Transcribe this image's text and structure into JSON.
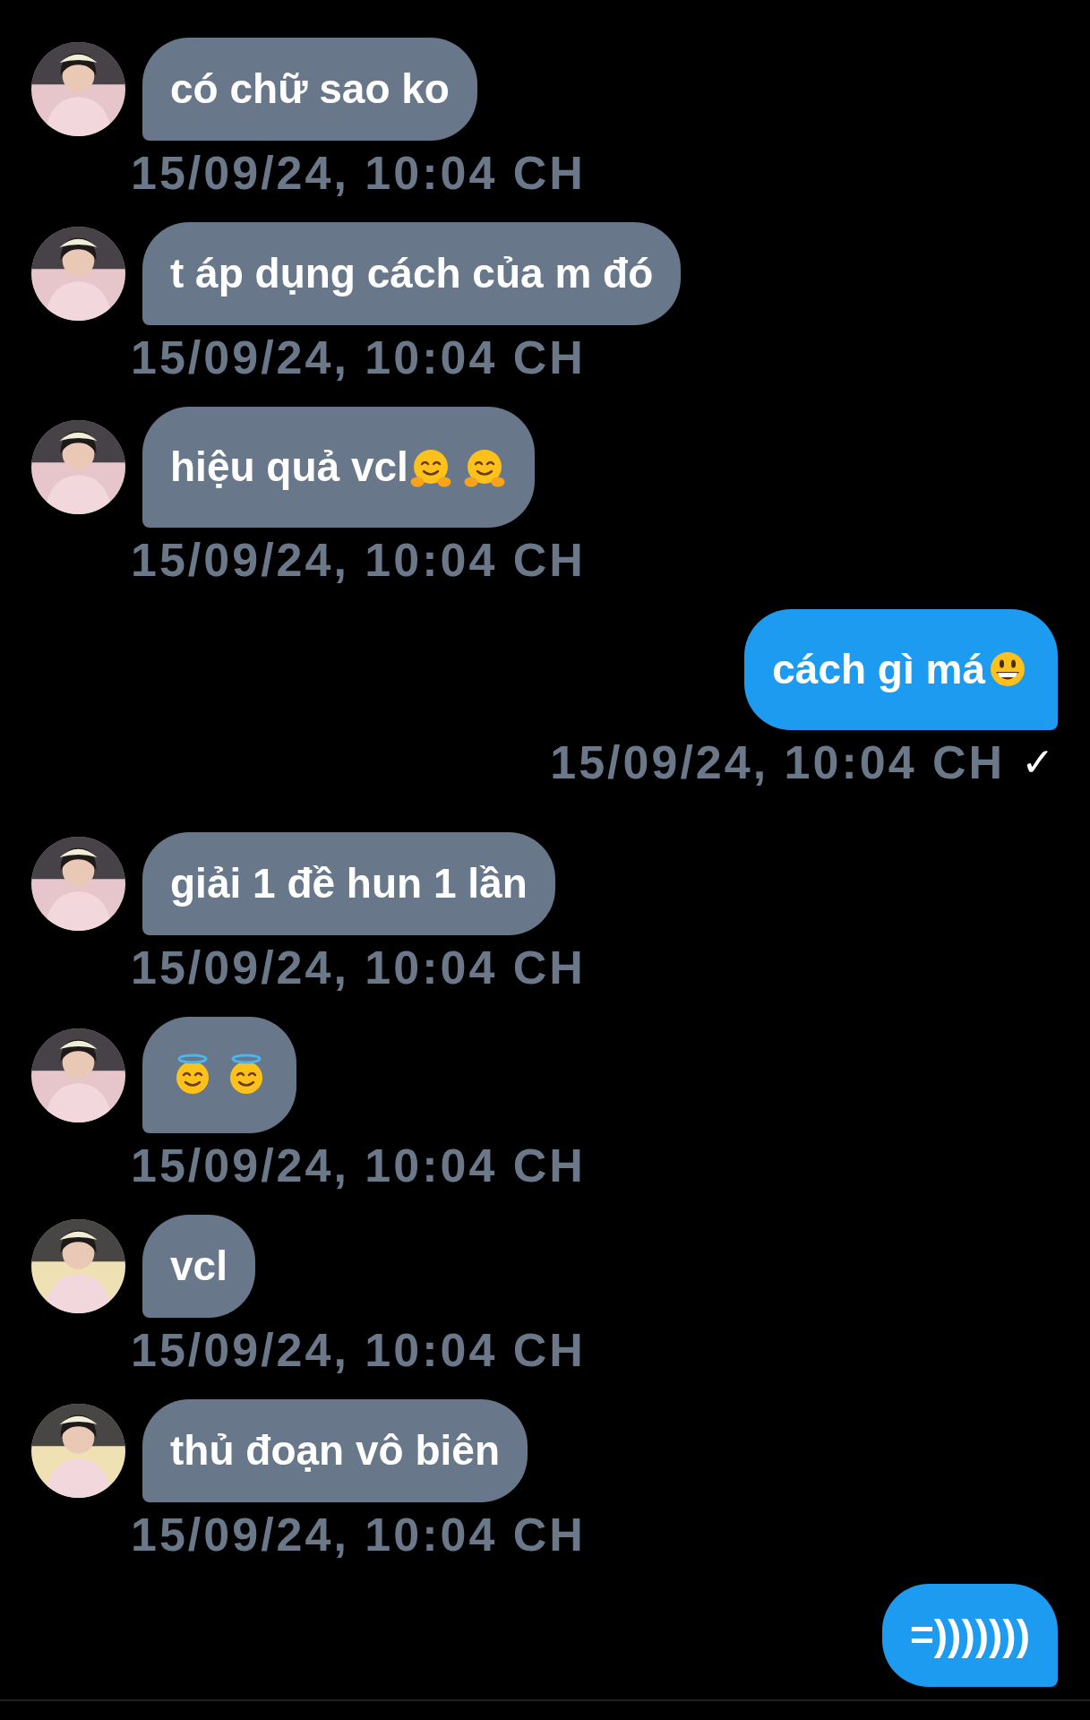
{
  "messages": [
    {
      "kind": "received",
      "avatar": {
        "kind": "picture",
        "color": "#e6c6cb"
      },
      "parts": [
        {
          "kind": "text",
          "text": "có chữ sao ko"
        }
      ],
      "timestamp": "15/09/24, 10:04 CH"
    },
    {
      "kind": "received",
      "avatar": {
        "kind": "picture",
        "color": "#e6c6cb"
      },
      "parts": [
        {
          "kind": "text",
          "text": "t áp dụng cách của m đó"
        }
      ],
      "timestamp": "15/09/24, 10:04 CH"
    },
    {
      "kind": "received",
      "avatar": {
        "kind": "picture",
        "color": "#e6c6cb"
      },
      "parts": [
        {
          "kind": "text",
          "text": "hiệu quả vcl"
        },
        {
          "kind": "hug"
        },
        {
          "kind": "hug"
        }
      ],
      "timestamp": "15/09/24, 10:04 CH"
    },
    {
      "kind": "sent",
      "parts": [
        {
          "kind": "text",
          "text": "cách gì má"
        },
        {
          "kind": "grin"
        }
      ],
      "timestamp": "15/09/24, 10:04 CH",
      "status_mark": "✓"
    },
    {
      "kind": "received",
      "avatar": {
        "kind": "picture",
        "color": "#e6c6cb"
      },
      "parts": [
        {
          "kind": "text",
          "text": "giải 1 đề hun 1 lần"
        }
      ],
      "timestamp": "15/09/24, 10:04 CH"
    },
    {
      "kind": "received",
      "avatar": {
        "kind": "picture",
        "color": "#e6c6cb"
      },
      "parts": [
        {
          "kind": "halo"
        },
        {
          "kind": "halo"
        }
      ],
      "timestamp": "15/09/24, 10:04 CH"
    },
    {
      "kind": "received",
      "avatar": {
        "kind": "picture",
        "color": "#efe1b4"
      },
      "parts": [
        {
          "kind": "text",
          "text": "vcl"
        }
      ],
      "timestamp": "15/09/24, 10:04 CH"
    },
    {
      "kind": "received",
      "avatar": {
        "kind": "picture",
        "color": "#efe1b4"
      },
      "parts": [
        {
          "kind": "text",
          "text": "thủ đoạn vô biên"
        }
      ],
      "timestamp": "15/09/24, 10:04 CH"
    },
    {
      "kind": "sent",
      "parts": [
        {
          "kind": "text",
          "text": "=)))))))"
        }
      ]
    }
  ]
}
